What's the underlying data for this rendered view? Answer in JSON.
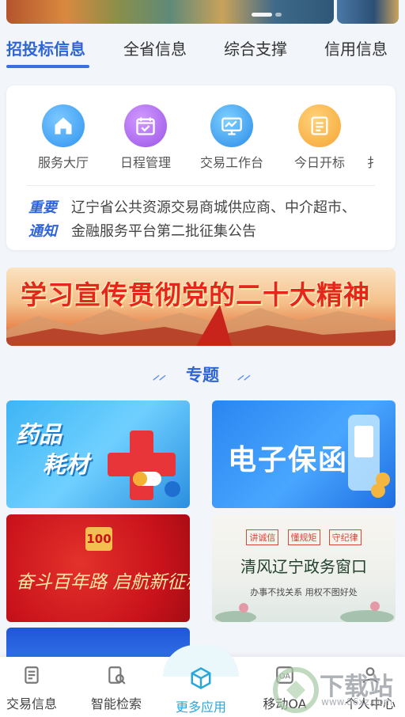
{
  "tabs": [
    {
      "label": "招投标信息",
      "active": true
    },
    {
      "label": "全省信息"
    },
    {
      "label": "综合支撑"
    },
    {
      "label": "信用信息"
    }
  ],
  "quick_actions": [
    {
      "label": "服务大厅",
      "icon": "home-icon"
    },
    {
      "label": "日程管理",
      "icon": "calendar-check-icon"
    },
    {
      "label": "交易工作台",
      "icon": "monitor-chart-icon"
    },
    {
      "label": "今日开标",
      "icon": "document-list-icon"
    },
    {
      "label": "扌"
    }
  ],
  "notice": {
    "tag_line1": "重要",
    "tag_line2": "通知",
    "text_line1": "辽宁省公共资源交易商城供应商、中介超市、",
    "text_line2": "金融服务平台第二批征集公告"
  },
  "banner": {
    "title": "学习宣传贯彻党的二十大精神"
  },
  "section": {
    "title": "专题",
    "deco": "⸝⸝"
  },
  "tiles": {
    "drug": {
      "line1": "药品",
      "line2": "耗材"
    },
    "bond": {
      "title": "电子保函"
    },
    "party": {
      "badge": "100",
      "title": "奋斗百年路 启航新征程"
    },
    "clean": {
      "tags": [
        "讲诚信",
        "懂规矩",
        "守纪律"
      ],
      "title": "清风辽宁政务窗口",
      "subtitle": "办事不找关系 用权不图好处"
    }
  },
  "bottom_nav": [
    {
      "label": "交易信息",
      "icon": "document-icon"
    },
    {
      "label": "智能检索",
      "icon": "search-doc-icon"
    },
    {
      "label": "更多应用",
      "icon": "cube-icon",
      "active": true
    },
    {
      "label": "移动OA",
      "icon": "oa-icon"
    },
    {
      "label": "个人中心",
      "icon": "user-icon"
    }
  ],
  "watermark": {
    "text": "下载站",
    "url": "www.86xz.com"
  },
  "colors": {
    "accent": "#2f64d8",
    "nav_active": "#2aa7d9"
  }
}
